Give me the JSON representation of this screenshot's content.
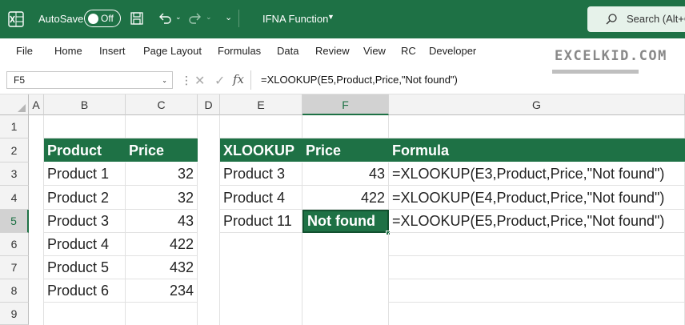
{
  "titlebar": {
    "autosave_label": "AutoSave",
    "autosave_state": "Off",
    "doc_title": "IFNA Function",
    "search_text": "Search (Alt+Q)"
  },
  "ribbon": {
    "tabs": [
      "File",
      "Home",
      "Insert",
      "Page Layout",
      "Formulas",
      "Data",
      "Review",
      "View",
      "RC",
      "Developer"
    ],
    "logo": "EXCELKID.COM"
  },
  "formula_bar": {
    "name_box": "F5",
    "formula": "=XLOOKUP(E5,Product,Price,\"Not found\")"
  },
  "grid": {
    "columns": [
      "A",
      "B",
      "C",
      "D",
      "E",
      "F",
      "G"
    ],
    "rows": [
      "1",
      "2",
      "3",
      "4",
      "5",
      "6",
      "7",
      "8",
      "9"
    ],
    "selected_column": "F",
    "selected_row": "5",
    "products_table": {
      "headers": [
        "Product",
        "Price"
      ],
      "rows": [
        [
          "Product 1",
          "32"
        ],
        [
          "Product 2",
          "32"
        ],
        [
          "Product 3",
          "43"
        ],
        [
          "Product 4",
          "422"
        ],
        [
          "Product 5",
          "432"
        ],
        [
          "Product 6",
          "234"
        ]
      ]
    },
    "lookup_table": {
      "headers": [
        "XLOOKUP",
        "Price",
        "Formula"
      ],
      "rows": [
        [
          "Product 3",
          "43",
          "=XLOOKUP(E3,Product,Price,\"Not found\")"
        ],
        [
          "Product 4",
          "422",
          "=XLOOKUP(E4,Product,Price,\"Not found\")"
        ],
        [
          "Product 11",
          "Not found",
          "=XLOOKUP(E5,Product,Price,\"Not found\")"
        ]
      ]
    }
  },
  "colors": {
    "brand_green": "#1e7145",
    "header_fill": "#1e7145"
  }
}
